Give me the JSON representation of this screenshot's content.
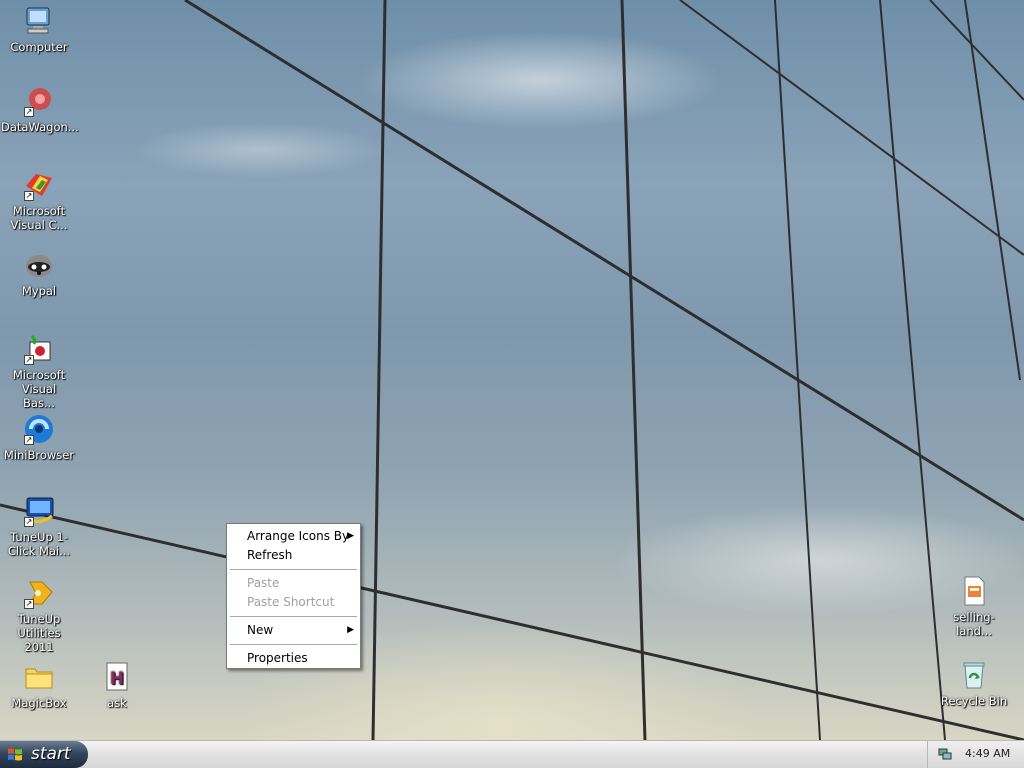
{
  "desktop": {
    "icons_left": [
      {
        "label": "Computer",
        "icon": "computer-icon",
        "shortcut": false
      },
      {
        "label": "DataWagon...",
        "icon": "datawagon-icon",
        "shortcut": true
      },
      {
        "label": "Microsoft Visual C...",
        "icon": "visual-c-icon",
        "shortcut": true
      },
      {
        "label": "Mypal",
        "icon": "mypal-icon",
        "shortcut": false
      },
      {
        "label": "Microsoft Visual Bas...",
        "icon": "visual-basic-icon",
        "shortcut": true
      },
      {
        "label": "MiniBrowser",
        "icon": "minibrowser-icon",
        "shortcut": true
      },
      {
        "label": "TuneUp 1-Click Mai...",
        "icon": "tuneup-1click-icon",
        "shortcut": true
      },
      {
        "label": "TuneUp Utilities 2011",
        "icon": "tuneup-utilities-icon",
        "shortcut": true
      },
      {
        "label": "MagicBox",
        "icon": "folder-icon",
        "shortcut": false
      },
      {
        "label": "ask",
        "icon": "text-file-icon",
        "shortcut": false
      }
    ],
    "icons_right": [
      {
        "label": "selling-land...",
        "icon": "document-icon",
        "shortcut": false
      },
      {
        "label": "Recycle Bin",
        "icon": "recycle-bin-icon",
        "shortcut": false
      }
    ]
  },
  "context_menu": {
    "arrange_icons_by": "Arrange Icons By",
    "refresh": "Refresh",
    "paste": "Paste",
    "paste_shortcut": "Paste Shortcut",
    "new": "New",
    "properties": "Properties",
    "submenu_arrow": "▶"
  },
  "taskbar": {
    "start_label": "start",
    "clock": "4:49 AM",
    "tray_icon": "network-icon"
  },
  "colors": {
    "taskbar": "#dcdcdc",
    "start_button": "#2c3b4f",
    "menu_disabled": "#a0a0a0"
  }
}
